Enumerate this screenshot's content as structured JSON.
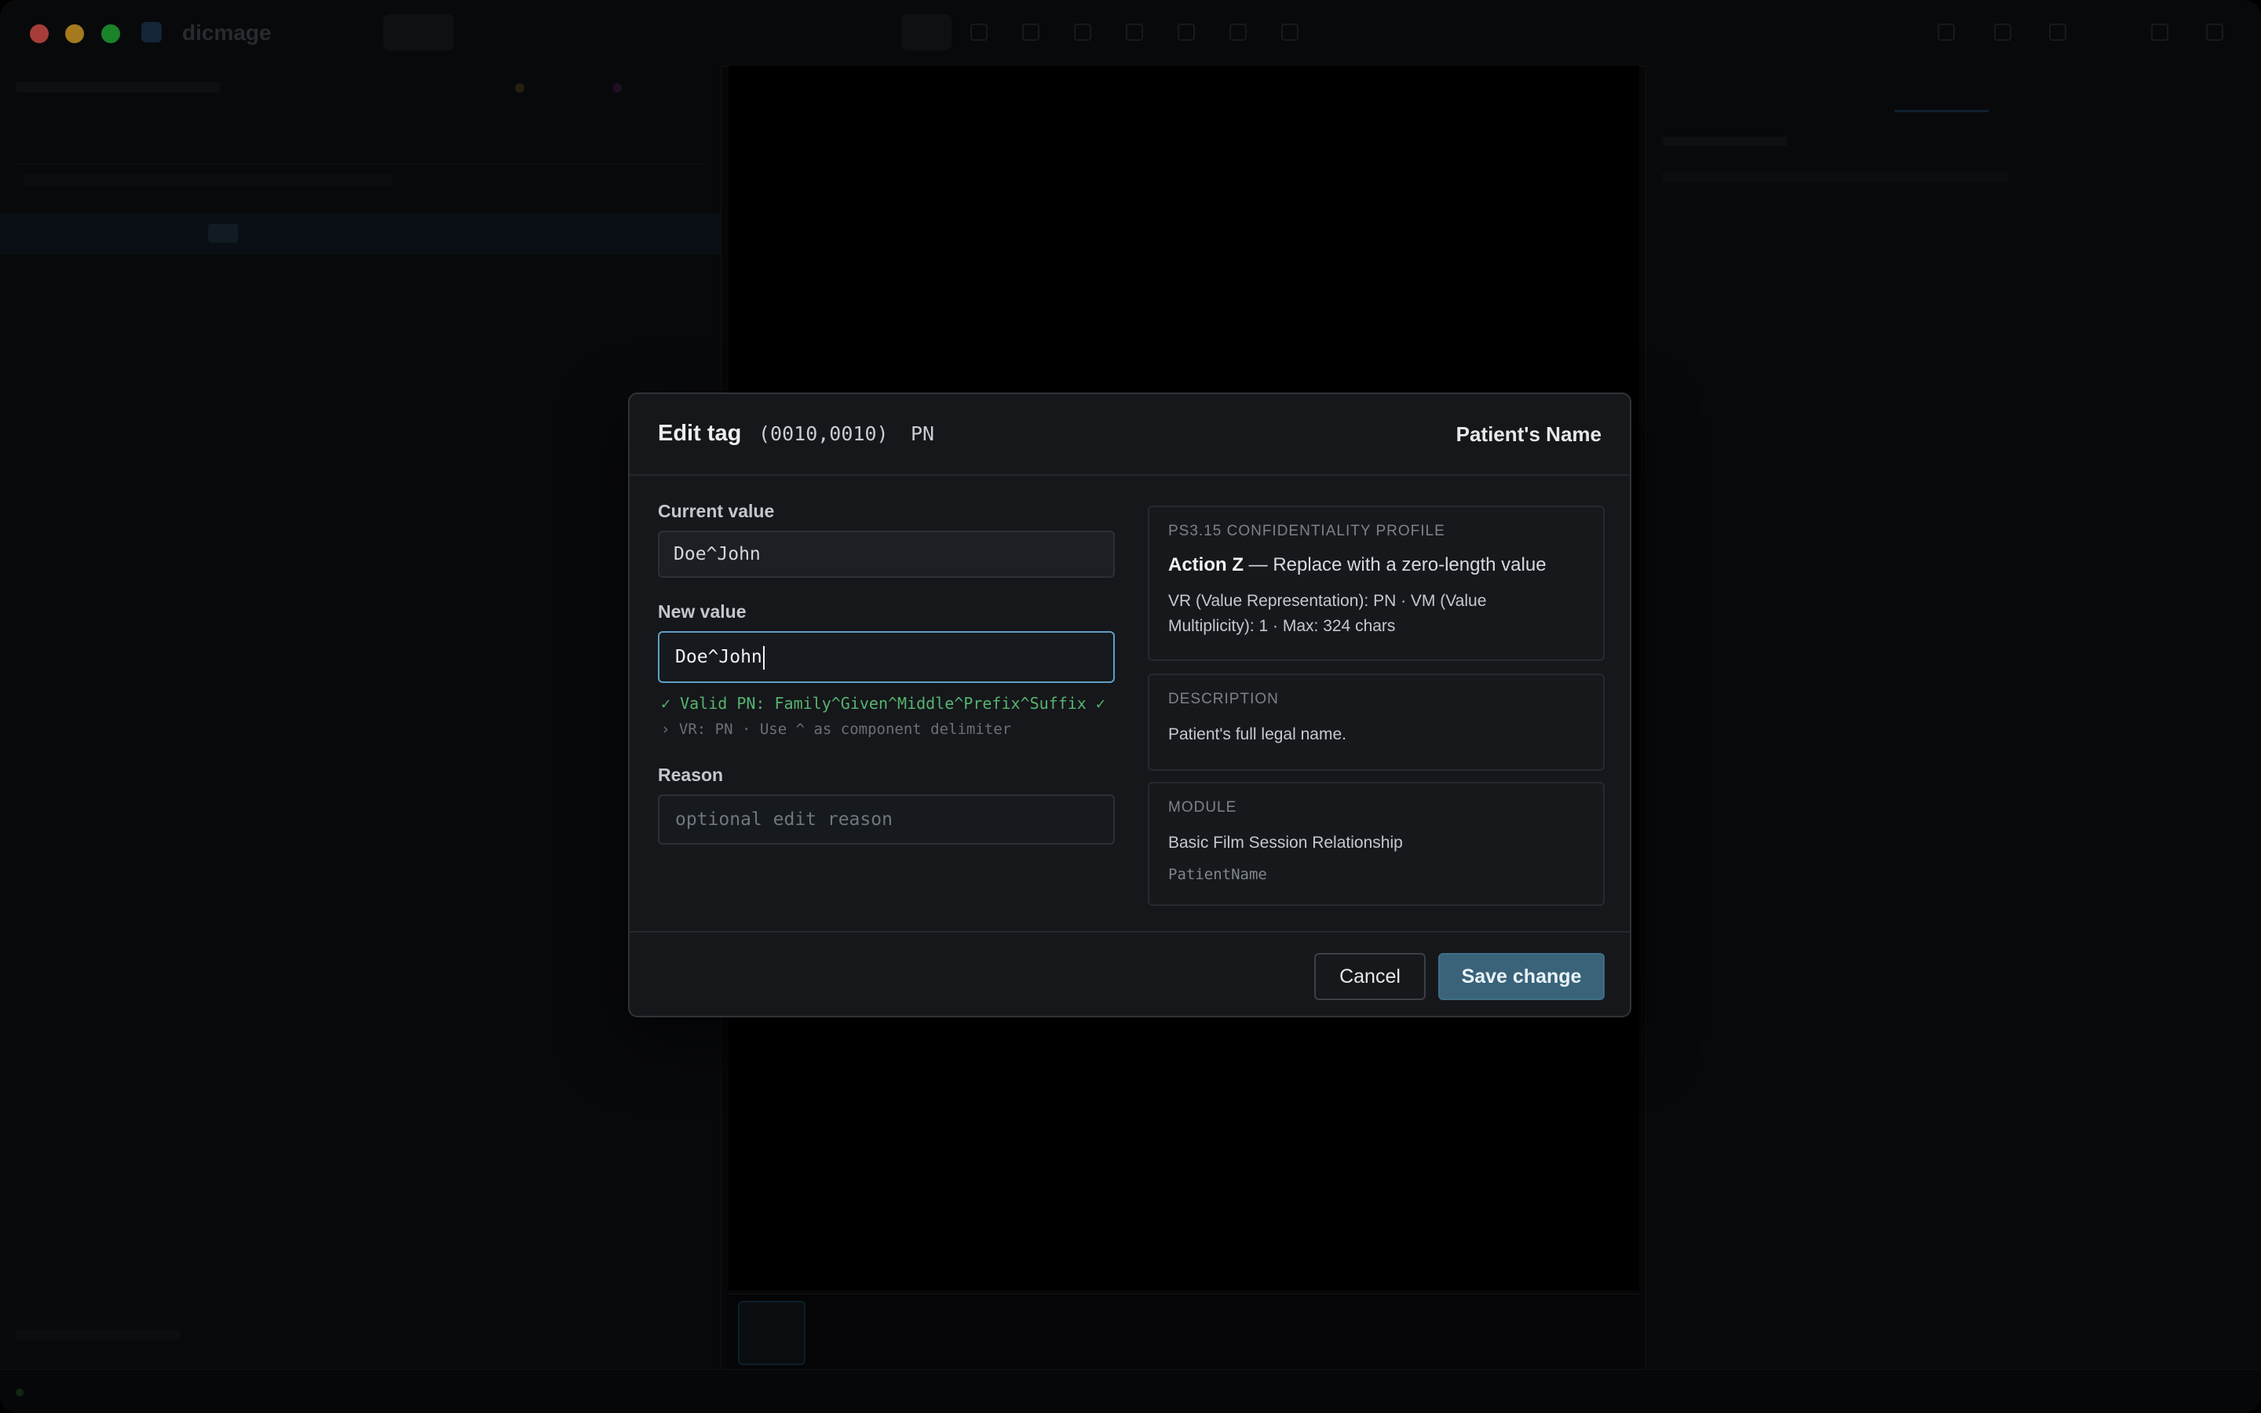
{
  "app": {
    "title": "dicmage"
  },
  "modal": {
    "title": "Edit tag",
    "tag": "(0010,0010)",
    "vr": "PN",
    "tag_name": "Patient's Name",
    "current_value_label": "Current value",
    "current_value": "Doe^John",
    "new_value_label": "New value",
    "new_value": "Doe^John",
    "validation_ok": "✓ Valid PN: Family^Given^Middle^Prefix^Suffix ✓",
    "validation_hint": "› VR: PN · Use ^ as component delimiter",
    "reason_label": "Reason",
    "reason_placeholder": "optional edit reason",
    "profile": {
      "heading": "PS3.15 CONFIDENTIALITY PROFILE",
      "action_strong": "Action Z",
      "action_rest": " — Replace with a zero-length value",
      "line1": "VR (Value Representation): PN · VM (Value",
      "line2": "Multiplicity): 1 · Max: 324 chars"
    },
    "description": {
      "heading": "DESCRIPTION",
      "text": "Patient's full legal name."
    },
    "module": {
      "heading": "MODULE",
      "name": "Basic Film Session Relationship",
      "keyword": "PatientName"
    },
    "cancel_label": "Cancel",
    "save_label": "Save change"
  },
  "colors": {
    "accent": "#5f9fc4",
    "save_button": "#3a6379",
    "valid_text": "#57b36e",
    "close_light": "#ff5f57",
    "minimize_light": "#febc2e",
    "zoom_light": "#28c840"
  }
}
